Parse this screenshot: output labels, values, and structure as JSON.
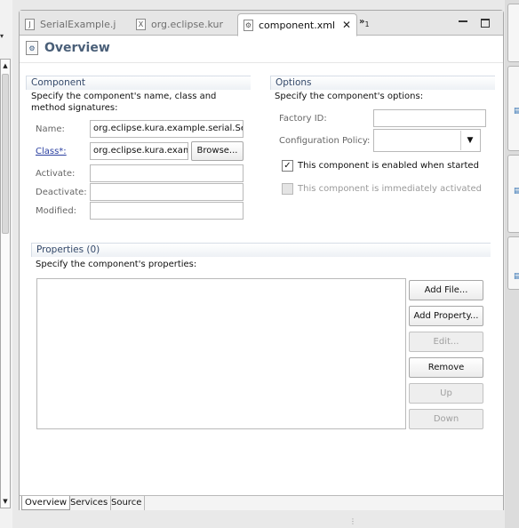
{
  "tabs": [
    {
      "label": "SerialExample.j",
      "icon": "java-file-icon",
      "glyph": "J"
    },
    {
      "label": "org.eclipse.kur",
      "icon": "manifest-file-icon",
      "glyph": "X"
    },
    {
      "label": "component.xml",
      "icon": "component-file-icon",
      "glyph": "⚙",
      "close": "✕"
    }
  ],
  "overflow": {
    "symbol": "»",
    "count": "1"
  },
  "editor": {
    "title": "Overview"
  },
  "component": {
    "heading": "Component",
    "description": "Specify the component's name, class and method signatures:",
    "name_label": "Name:",
    "name_value": "org.eclipse.kura.example.serial.SerialExample",
    "class_label": "Class*:",
    "class_value": "org.eclipse.kura.example.serial.SerialExample",
    "browse_label": "Browse...",
    "activate_label": "Activate:",
    "activate_value": "",
    "deactivate_label": "Deactivate:",
    "deactivate_value": "",
    "modified_label": "Modified:",
    "modified_value": ""
  },
  "options": {
    "heading": "Options",
    "description": "Specify the component's options:",
    "factory_label": "Factory ID:",
    "factory_value": "",
    "config_policy_label": "Configuration Policy:",
    "config_policy_value": "",
    "enabled_label": "This component is enabled when started",
    "enabled_checked": true,
    "immediate_label": "This component is immediately activated",
    "immediate_checked": false
  },
  "properties": {
    "heading": "Properties (0)",
    "description": "Specify the component's properties:",
    "buttons": [
      {
        "label": "Add File...",
        "enabled": true
      },
      {
        "label": "Add Property...",
        "enabled": true
      },
      {
        "label": "Edit...",
        "enabled": false
      },
      {
        "label": "Remove",
        "enabled": true
      },
      {
        "label": "Up",
        "enabled": false
      },
      {
        "label": "Down",
        "enabled": false
      }
    ]
  },
  "bottom_tabs": [
    {
      "label": "Overview",
      "active": true
    },
    {
      "label": "Services",
      "active": false
    },
    {
      "label": "Source",
      "active": false
    }
  ],
  "colors": {
    "section_title": "#34496a",
    "header_title": "#4a5f78",
    "link": "#2a3fa0"
  }
}
